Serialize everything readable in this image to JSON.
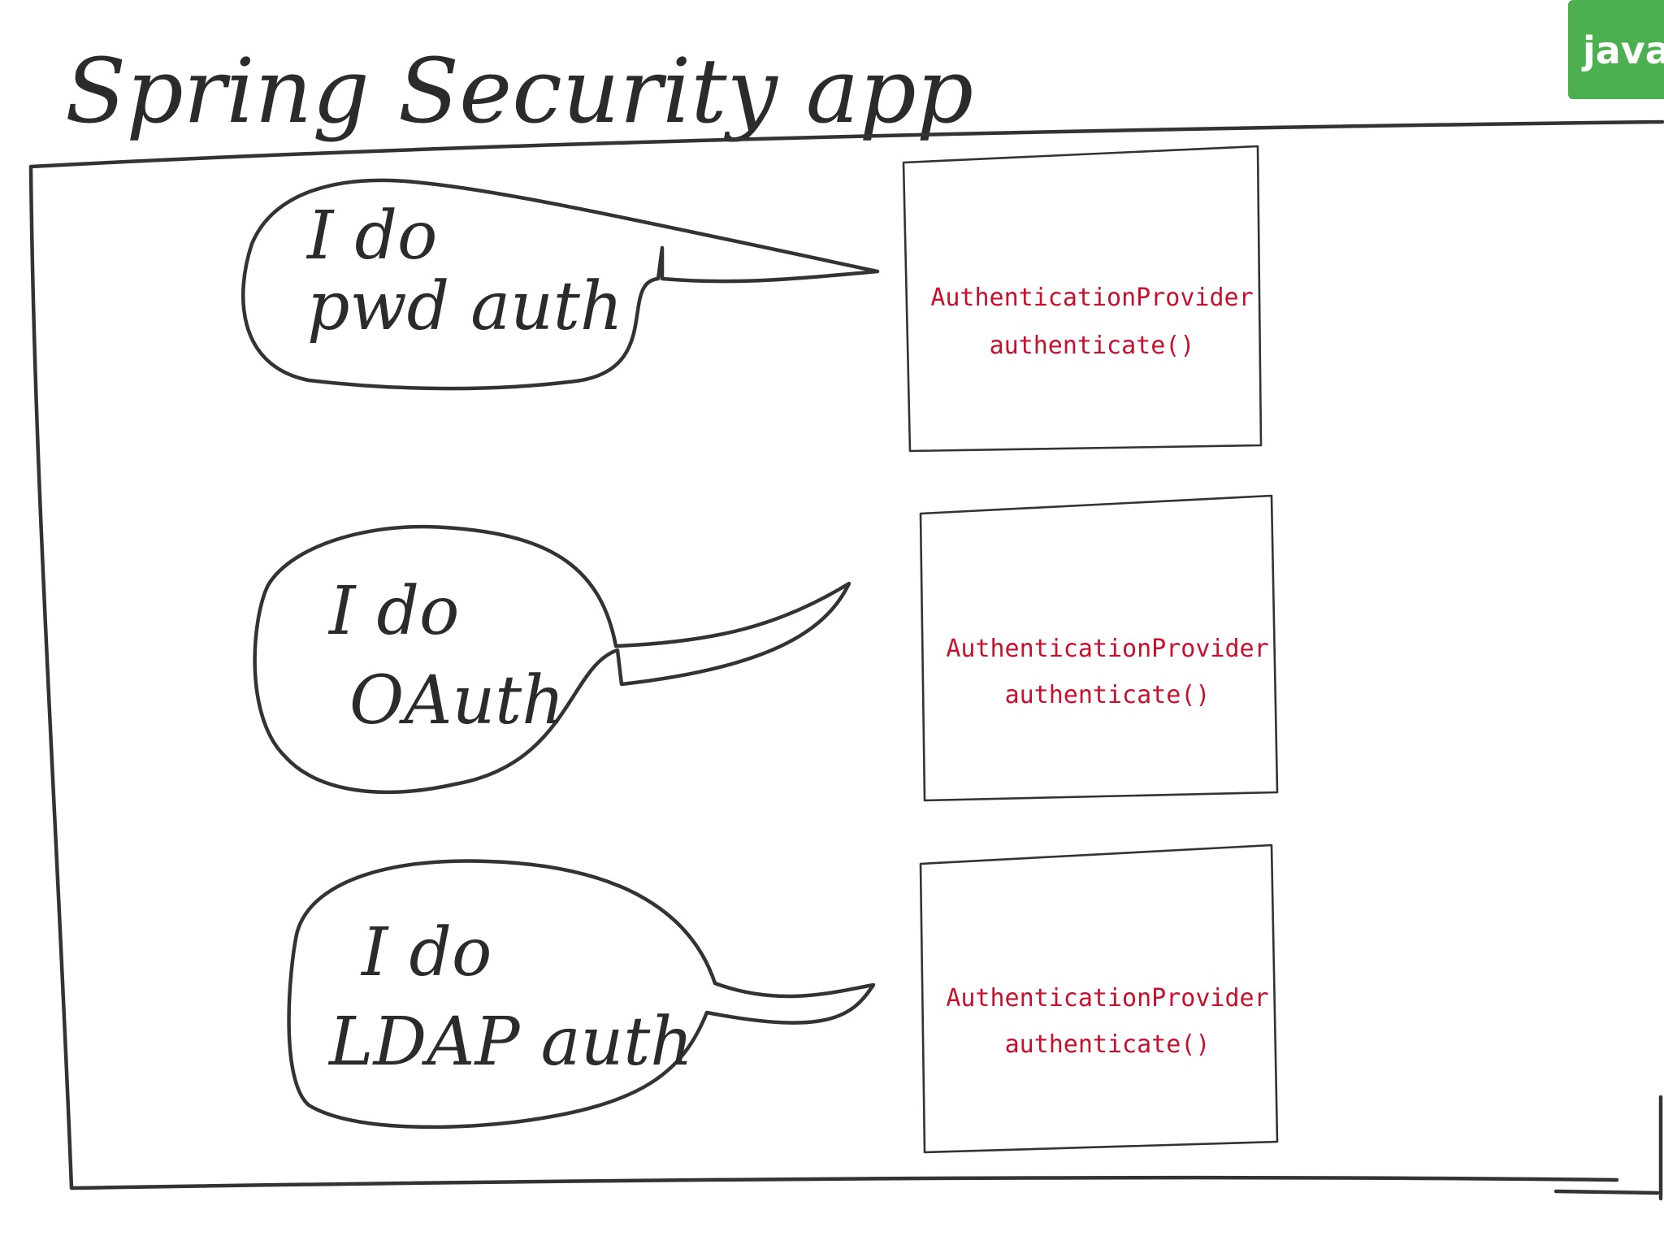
{
  "title": "Spring Security app",
  "corner_tag": {
    "label": "java",
    "color": "#4caf50"
  },
  "code_color": "#c8102e",
  "bubbles": [
    {
      "line1": "I do",
      "line2": "pwd auth"
    },
    {
      "line1": "I do",
      "line2": "OAuth"
    },
    {
      "line1": "I do",
      "line2": "LDAP auth"
    }
  ],
  "providers": [
    {
      "name": "AuthenticationProvider",
      "method": "authenticate()"
    },
    {
      "name": "AuthenticationProvider",
      "method": "authenticate()"
    },
    {
      "name": "AuthenticationProvider",
      "method": "authenticate()"
    }
  ]
}
